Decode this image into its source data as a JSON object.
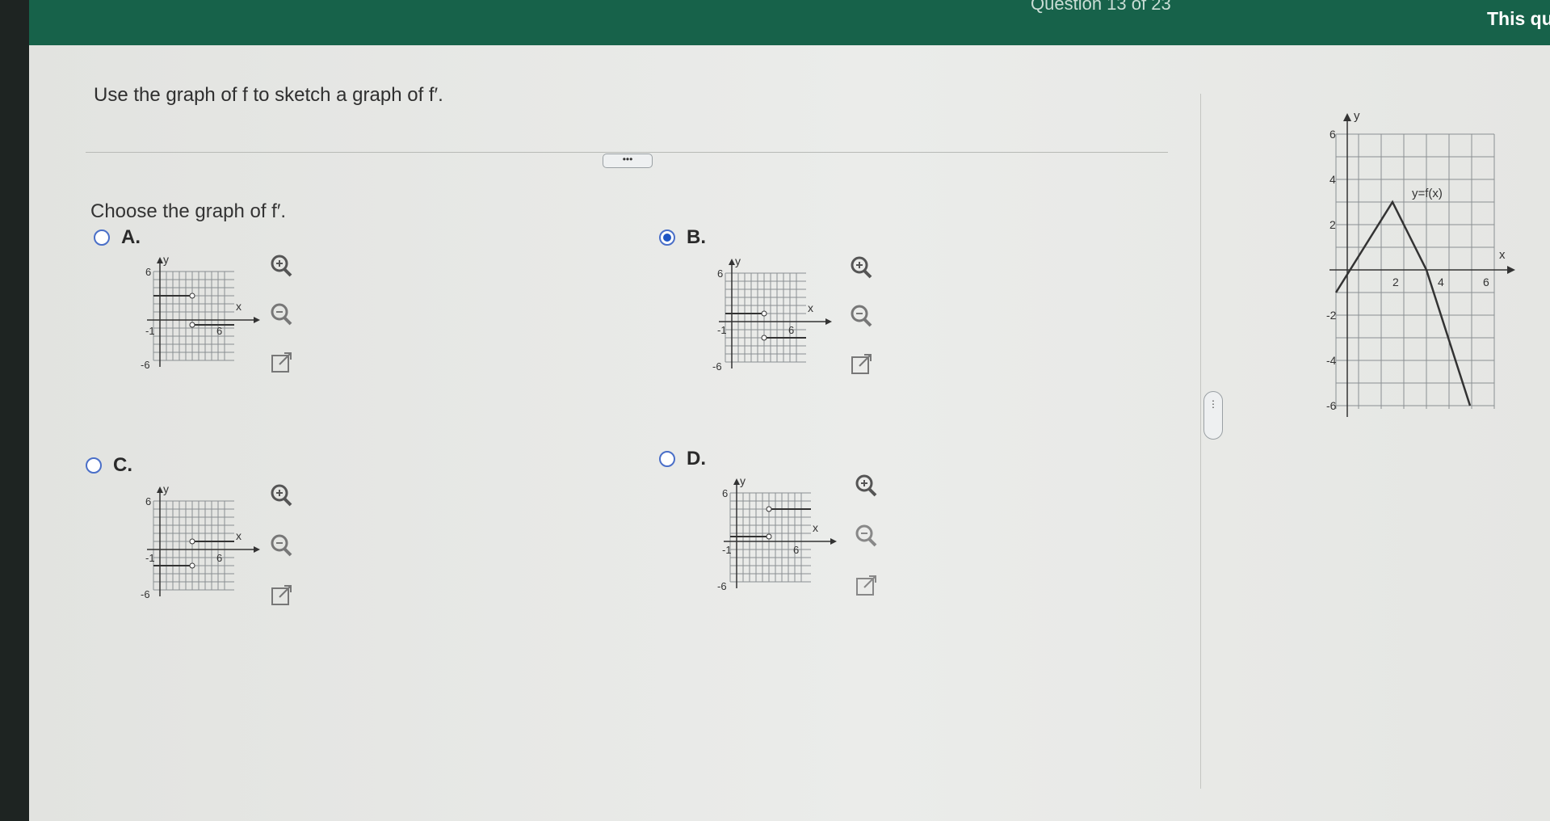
{
  "topbar": {
    "progress": "Question 13 of 23",
    "question_info": "This quest"
  },
  "question": {
    "instruction": "Use the graph of f to sketch a graph of f′.",
    "prompt": "Choose the graph of f′."
  },
  "more_button": "•••",
  "split_handle": "⋮",
  "choices": [
    {
      "letter": "A.",
      "selected": false
    },
    {
      "letter": "B.",
      "selected": true
    },
    {
      "letter": "C.",
      "selected": false
    },
    {
      "letter": "D.",
      "selected": false
    }
  ],
  "mini_graph": {
    "x_label": "x",
    "y_label": "y",
    "y_top": "6",
    "y_bottom": "-6",
    "x_right": "6",
    "tick_neg": "-1"
  },
  "main_graph": {
    "function_label": "y=f(x)",
    "x_label": "x",
    "y_label": "y",
    "x_ticks": [
      "2",
      "4",
      "6"
    ],
    "y_ticks": [
      "6",
      "4",
      "2",
      "-2",
      "-4",
      "-6"
    ]
  },
  "colors": {
    "topbar": "#17624a",
    "radio": "#1f56c4",
    "grid": "#8a8f92"
  },
  "icons": [
    "zoom-in-icon",
    "zoom-out-icon",
    "open-external-icon"
  ]
}
